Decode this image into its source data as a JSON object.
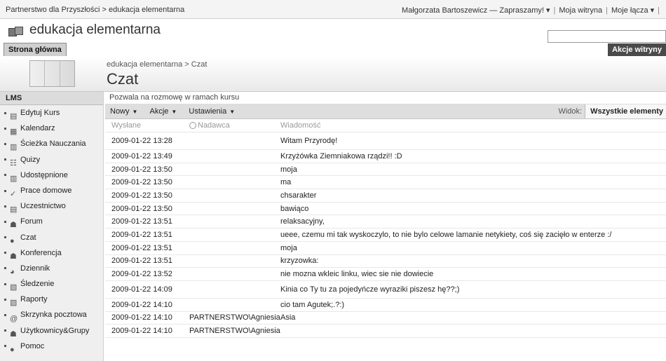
{
  "topbar": {
    "breadcrumb": "Partnerstwo dla Przyszłości > edukacja elementarna",
    "welcome": "Małgorzata Bartoszewicz — Zapraszamy! ▾",
    "my_site": "Moja witryna",
    "my_links": "Moje łącza ▾",
    "trail": "|"
  },
  "site": {
    "title": "edukacja elementarna"
  },
  "nav": {
    "home_tab": "Strona główna",
    "site_actions": "Akcje witryny"
  },
  "page": {
    "breadcrumb": "edukacja elementarna > Czat",
    "title": "Czat"
  },
  "sidebar": {
    "heading": "LMS",
    "items": [
      {
        "label": "Edytuj Kurs",
        "icon": "edit-course-icon"
      },
      {
        "label": "Kalendarz",
        "icon": "calendar-icon"
      },
      {
        "label": "Ścieżka Nauczania",
        "icon": "learning-path-icon"
      },
      {
        "label": "Quizy",
        "icon": "quiz-icon"
      },
      {
        "label": "Udostępnione",
        "icon": "shared-icon"
      },
      {
        "label": "Prace domowe",
        "icon": "checkmark-icon"
      },
      {
        "label": "Uczestnictwo",
        "icon": "attendance-icon"
      },
      {
        "label": "Forum",
        "icon": "forum-icon"
      },
      {
        "label": "Czat",
        "icon": "chat-bubble-icon"
      },
      {
        "label": "Konferencja",
        "icon": "conference-icon"
      },
      {
        "label": "Dziennik",
        "icon": "journal-icon"
      },
      {
        "label": "Śledzenie",
        "icon": "tracking-icon"
      },
      {
        "label": "Raporty",
        "icon": "reports-icon"
      },
      {
        "label": "Skrzynka pocztowa",
        "icon": "at-sign-icon"
      },
      {
        "label": "Użytkownicy&Grupy",
        "icon": "users-groups-icon"
      },
      {
        "label": "Pomoc",
        "icon": "help-icon"
      }
    ]
  },
  "list": {
    "description": "Pozwala na rozmowę w ramach kursu",
    "toolbar": {
      "new": "Nowy",
      "actions": "Akcje",
      "settings": "Ustawienia",
      "view_label": "Widok:",
      "view_value": "Wszystkie elementy"
    },
    "columns": [
      "Wysłane",
      "Nadawca",
      "Wiadomość"
    ],
    "rows": [
      {
        "sent": "2009-01-22 13:28",
        "sender": "",
        "message": "Witam Przyrodę!",
        "tall": true
      },
      {
        "sent": "2009-01-22 13:49",
        "sender": "",
        "message": "Krzyżówka Ziemniakowa rządzi!! :D"
      },
      {
        "sent": "2009-01-22 13:50",
        "sender": "",
        "message": "moja"
      },
      {
        "sent": "2009-01-22 13:50",
        "sender": "",
        "message": "ma"
      },
      {
        "sent": "2009-01-22 13:50",
        "sender": "",
        "message": "chsarakter"
      },
      {
        "sent": "2009-01-22 13:50",
        "sender": "",
        "message": "bawiąco"
      },
      {
        "sent": "2009-01-22 13:51",
        "sender": "",
        "message": "relaksacyjny,"
      },
      {
        "sent": "2009-01-22 13:51",
        "sender": "",
        "message": "ueee, czemu mi tak wyskoczylo, to nie bylo celowe lamanie netykiety, coś się zacięło w enterze :/"
      },
      {
        "sent": "2009-01-22 13:51",
        "sender": "",
        "message": "moja"
      },
      {
        "sent": "2009-01-22 13:51",
        "sender": "",
        "message": "krzyzowka:"
      },
      {
        "sent": "2009-01-22 13:52",
        "sender": "",
        "message": "nie mozna wkleic linku, wiec sie nie dowiecie"
      },
      {
        "sent": "2009-01-22 14:09",
        "sender": "",
        "message": "Kinia co Ty tu za pojedyńcze wyraziki piszesz hę??;)",
        "tall": true
      },
      {
        "sent": "2009-01-22 14:10",
        "sender": "",
        "message": "cio tam Agutek;.?:)"
      },
      {
        "sent": "2009-01-22 14:10",
        "sender": "PARTNERSTWO\\AgniesiaS",
        "message": "Asia"
      },
      {
        "sent": "2009-01-22 14:10",
        "sender": "PARTNERSTWO\\AgniesiaS",
        "message": ""
      }
    ]
  }
}
